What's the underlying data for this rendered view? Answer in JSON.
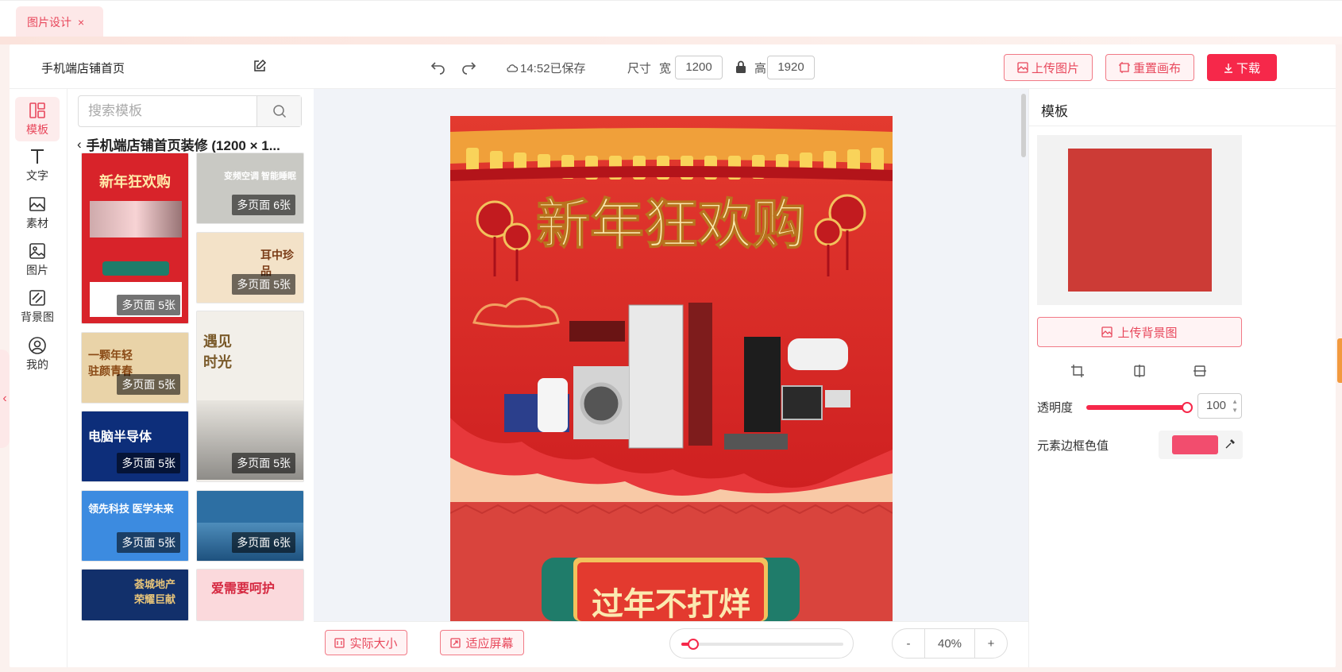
{
  "tab": {
    "label": "图片设计",
    "close": "×"
  },
  "header": {
    "project_title": "手机端店铺首页",
    "save_status": "14:52已保存",
    "size_label": "尺寸",
    "width_label": "宽",
    "width_value": "1200",
    "height_label": "高",
    "height_value": "1920",
    "upload_image": "上传图片",
    "reset_canvas": "重置画布",
    "download": "下载"
  },
  "rail": {
    "items": [
      {
        "label": "模板",
        "icon": "template-icon"
      },
      {
        "label": "文字",
        "icon": "text-icon"
      },
      {
        "label": "素材",
        "icon": "material-icon"
      },
      {
        "label": "图片",
        "icon": "image-icon"
      },
      {
        "label": "背景图",
        "icon": "background-icon"
      },
      {
        "label": "我的",
        "icon": "user-icon"
      }
    ],
    "collapse": "‹"
  },
  "templates": {
    "search_placeholder": "搜索模板",
    "breadcrumb": "手机端店铺首页装修 (1200 × 1...",
    "items": [
      {
        "title": "新年狂欢购",
        "badge": "多页面 5张",
        "bg": "#d8232a",
        "title_color": "#ffe9a8"
      },
      {
        "title": "变频空调 智能睡眠",
        "badge": "多页面 6张",
        "bg": "#c9c9c4",
        "title_color": "#ffffff"
      },
      {
        "title": "耳中珍品",
        "badge": "多页面 5张",
        "bg": "#f3e2c8",
        "title_color": "#7a3b16"
      },
      {
        "title": "一颗年轻 驻颜青春",
        "badge": "多页面 5张",
        "bg": "#e9d3a8",
        "title_color": "#8a4a16"
      },
      {
        "title": "遇见 时光",
        "badge": "多页面 5张",
        "bg": "#f2efe9",
        "title_color": "#7a5a2a"
      },
      {
        "title": "电脑半导体",
        "badge": "多页面 5张",
        "bg": "#0d2e7a",
        "title_color": "#ffffff"
      },
      {
        "title": "领先科技 医学未来",
        "badge": "多页面 5张",
        "bg": "#3c8be0",
        "title_color": "#ffffff"
      },
      {
        "title": "",
        "badge": "多页面 6张",
        "bg": "#2d6fa3",
        "title_color": "#ffffff"
      },
      {
        "title": "荟城地产 荣耀巨献",
        "badge": "多页面 5张",
        "bg": "#12306b",
        "title_color": "#e8c57a"
      },
      {
        "title": "爱需要呵护",
        "badge": "",
        "bg": "#fbd9dc",
        "title_color": "#d52840"
      }
    ]
  },
  "artboard": {
    "headline": "新年狂欢购",
    "bottom_text": "过年不打烊"
  },
  "bottombar": {
    "actual_size": "实际大小",
    "fit_screen": "适应屏幕",
    "zoom_minus": "-",
    "zoom_value": "40%",
    "zoom_plus": "+",
    "zoom_fraction": 0.04
  },
  "right_panel": {
    "title": "模板",
    "upload_background": "上传背景图",
    "opacity_label": "透明度",
    "opacity_value": "100",
    "border_color_label": "元素边框色值",
    "border_color": "#f24d6e"
  },
  "colors": {
    "accent": "#f6284a",
    "accent_light": "#fff3f4",
    "accent_text": "#e8485c"
  }
}
